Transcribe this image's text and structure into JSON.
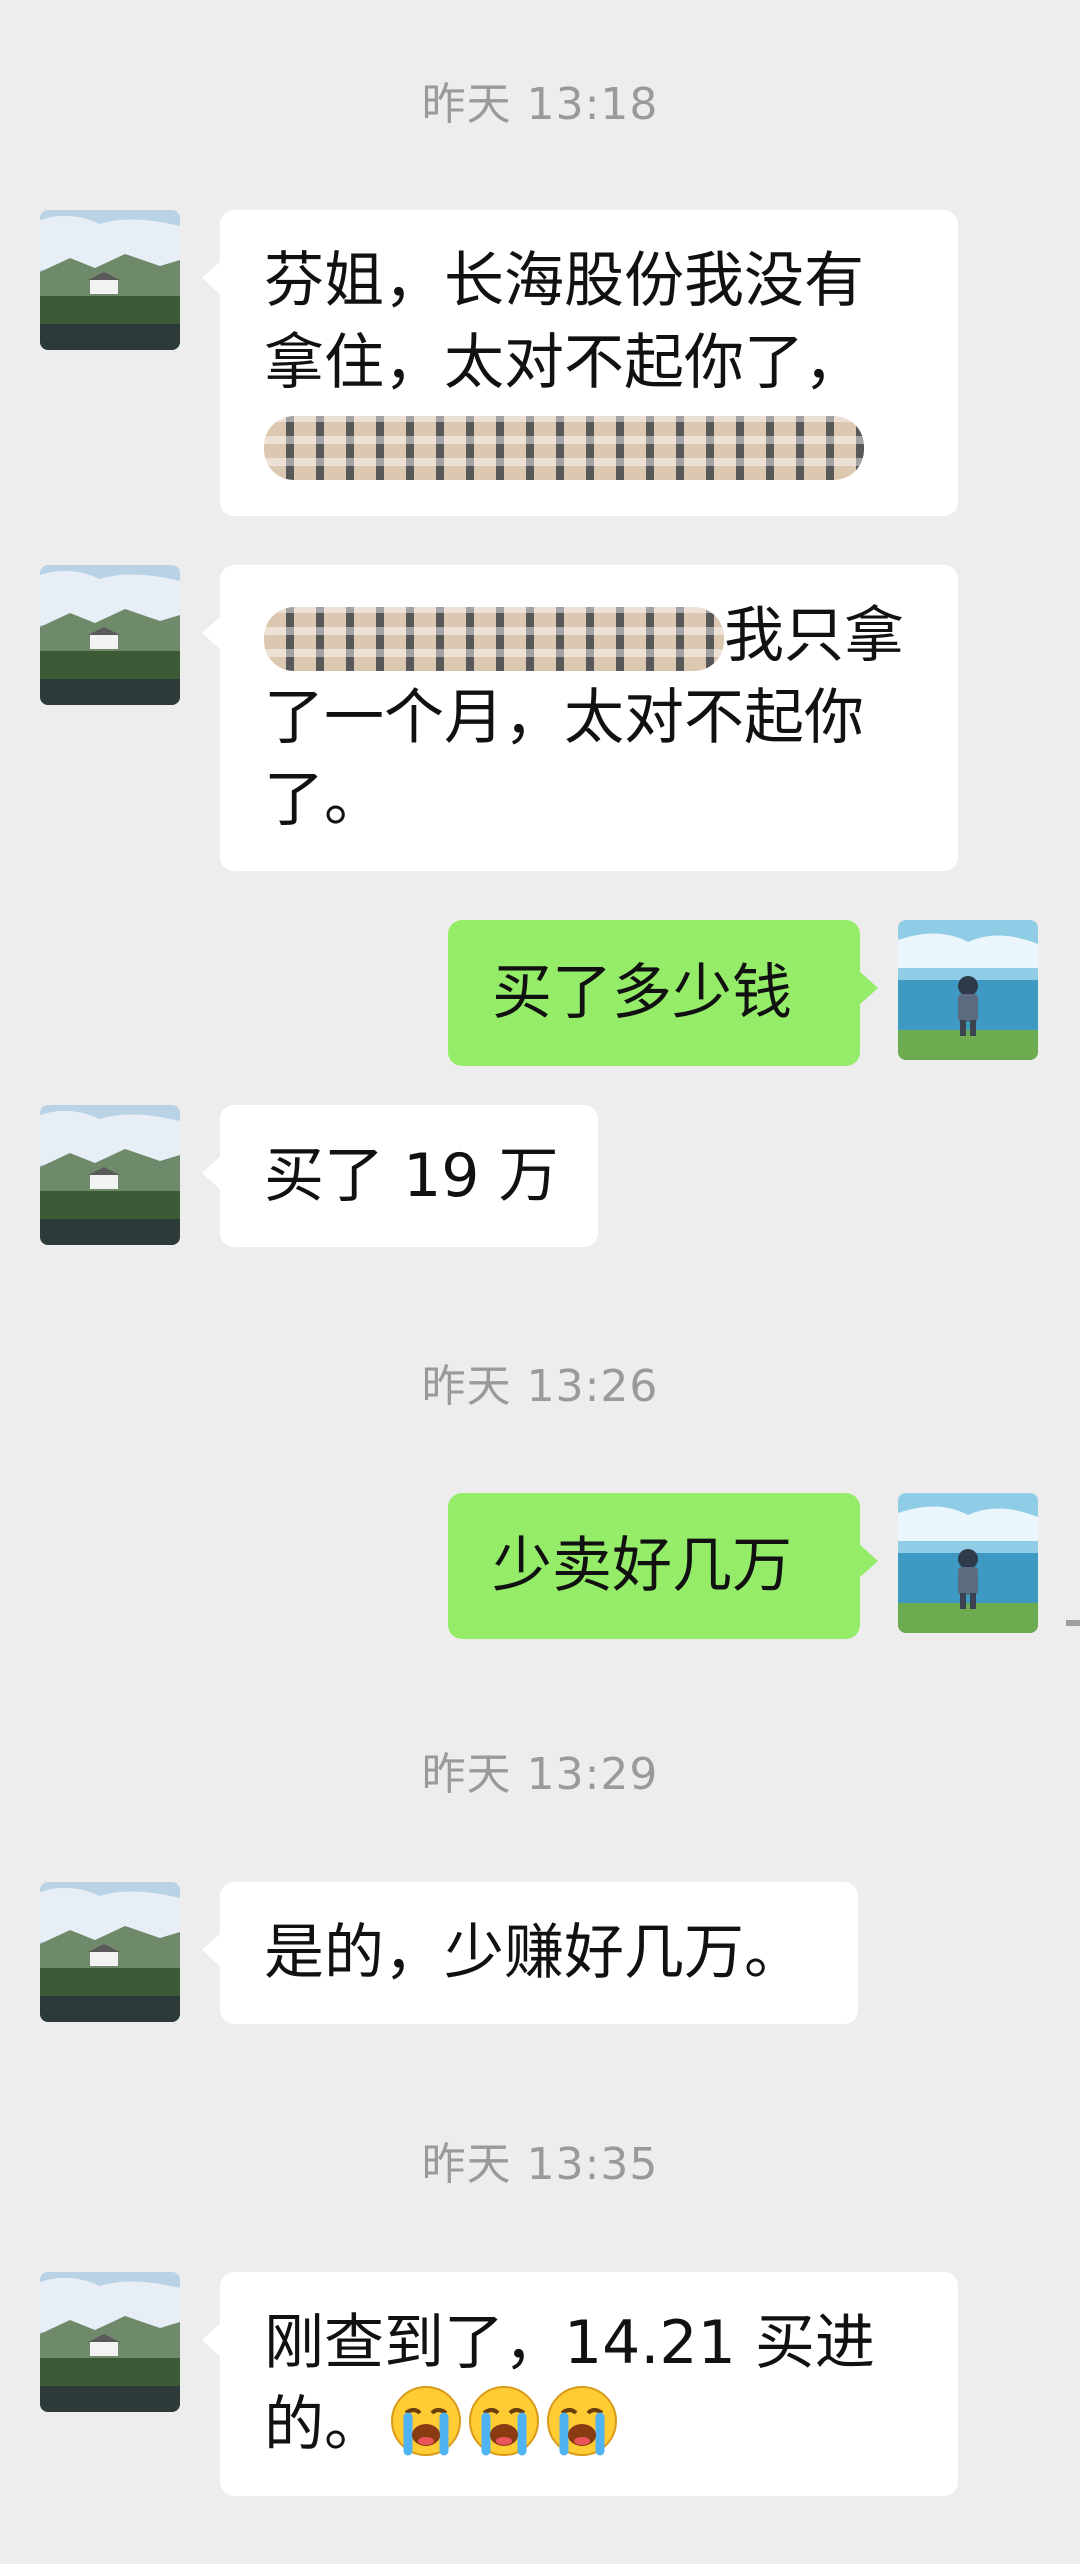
{
  "timestamps": [
    "昨天 13:18",
    "昨天 13:26",
    "昨天 13:29",
    "昨天 13:35"
  ],
  "messages": [
    {
      "lines": [
        "芬姐，长海股份我没有",
        "拿住，太对不起你了，"
      ],
      "avatar": "mountain-village-avatar-icon"
    },
    {
      "lines": [
        "我只拿",
        "了一个月，太对不起你",
        "了。"
      ]
    },
    {
      "lines": [
        "买了多少钱"
      ],
      "avatar": "boy-by-lake-avatar-icon"
    },
    {
      "lines": [
        "买了 19 万"
      ]
    },
    {
      "lines": [
        "少卖好几万"
      ]
    },
    {
      "lines": [
        "是的，少赚好几万。"
      ]
    },
    {
      "lines": [
        "刚查到了，14.21 买进",
        "的。"
      ],
      "emoji": "loudly-crying-face-icon"
    }
  ],
  "colors": {
    "background": "#ededed",
    "incoming": "#ffffff",
    "outgoing": "#95ec69"
  }
}
